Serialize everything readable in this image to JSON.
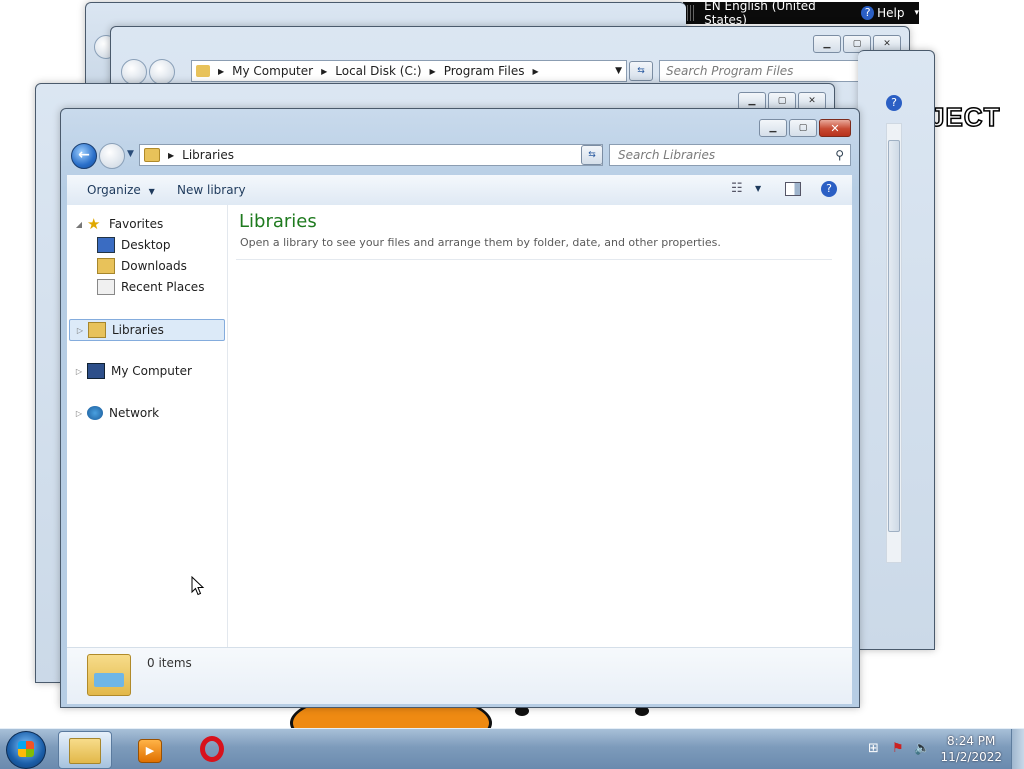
{
  "langbar": {
    "language": "EN English (United States)",
    "help": "Help"
  },
  "desktop_text": "JECT",
  "back_window": {
    "address": [
      "My Computer",
      "Local Disk (C:)",
      "Program Files"
    ],
    "search_placeholder": "Search Program Files"
  },
  "main_window": {
    "address": "Libraries",
    "search_placeholder": "Search Libraries",
    "toolbar": {
      "organize": "Organize",
      "new_library": "New library"
    },
    "nav": {
      "favorites": "Favorites",
      "desktop": "Desktop",
      "downloads": "Downloads",
      "recent_places": "Recent Places",
      "libraries": "Libraries",
      "my_computer": "My Computer",
      "network": "Network"
    },
    "content": {
      "title": "Libraries",
      "subtitle": "Open a library to see your files and arrange them by folder, date, and other properties."
    },
    "status": {
      "items": "0 items"
    }
  },
  "taskbar": {
    "time": "8:24 PM",
    "date": "11/2/2022"
  },
  "colors": {
    "title_green": "#1e7a1e",
    "selection": "#dceaf8"
  }
}
